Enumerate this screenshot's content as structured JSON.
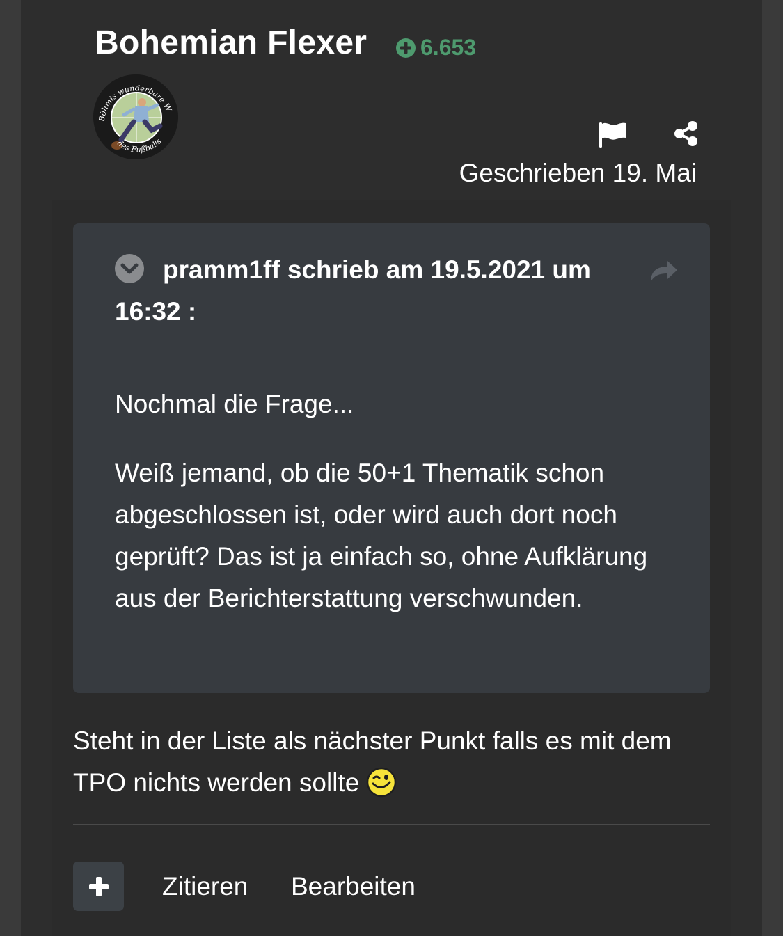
{
  "author": {
    "name": "Bohemian Flexer",
    "reputation": "6.653",
    "avatar_text_top": "Böhmis wunderbare Welt",
    "avatar_text_bottom": "des Fußballs",
    "avatar_icon": "football-player-avatar"
  },
  "post": {
    "posted": "Geschrieben 19. Mai",
    "report_icon": "flag-icon",
    "share_icon": "share-icon",
    "quote": {
      "header": "pramm1ff schrieb am 19.5.2021 um 16:32 :",
      "toggle_icon": "chevron-down-circle-icon",
      "goto_icon": "share-arrow-icon",
      "paragraphs": [
        "Nochmal die Frage...",
        "Weiß jemand, ob die 50+1 Thematik schon abgeschlossen ist, oder wird auch dort noch geprüft? Das ist ja einfach so, ohne Aufklärung aus der Berichterstattung verschwunden."
      ]
    },
    "reply": "Steht in der Liste als nächster Punkt falls es mit dem TPO nichts werden sollte",
    "reply_emoji": "wink-smiley-icon"
  },
  "actions": {
    "plus_icon": "plus-icon",
    "quote_label": "Zitieren",
    "edit_label": "Bearbeiten"
  },
  "colors": {
    "page_bg": "#2d2d2d",
    "quote_bg": "#373b40",
    "reputation": "#4e9a6e"
  }
}
